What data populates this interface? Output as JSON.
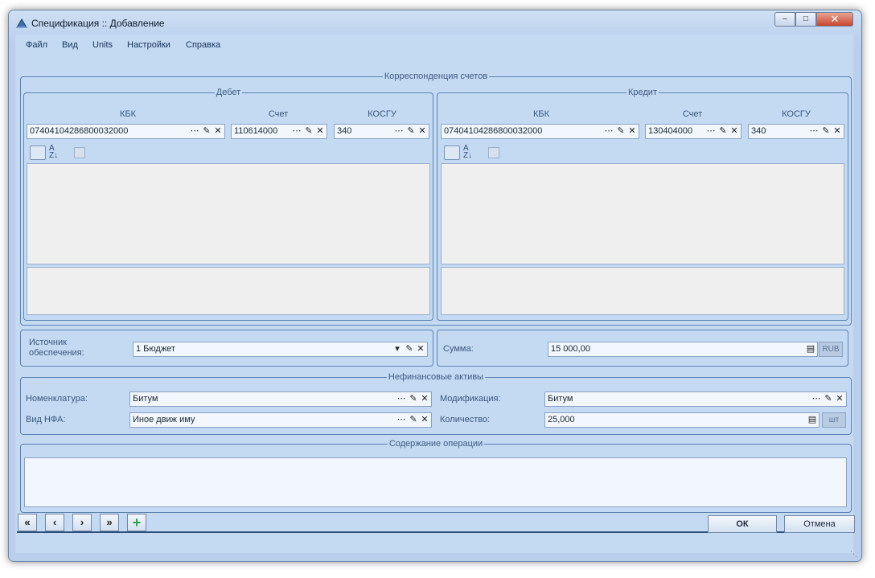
{
  "window": {
    "title": "Спецификация :: Добавление",
    "min": "–",
    "max": "□",
    "close": "✕"
  },
  "menu": [
    "Файл",
    "Вид",
    "Units",
    "Настройки",
    "Справка"
  ],
  "correspondence": {
    "legend": "Корреспонденция счетов",
    "debit": {
      "legend": "Дебет",
      "kbk_header": "КБК",
      "kbk": "07404104286800032000",
      "account_header": "Счет",
      "account": "110614000",
      "kosgu_header": "КОСГУ",
      "kosgu": "340"
    },
    "credit": {
      "legend": "Кредит",
      "kbk_header": "КБК",
      "kbk": "07404104286800032000",
      "account_header": "Счет",
      "account": "130404000",
      "kosgu_header": "КОСГУ",
      "kosgu": "340"
    }
  },
  "funding": {
    "label": "Источник обеспечения:",
    "value": "1 Бюджет"
  },
  "sum": {
    "label": "Сумма:",
    "value": "15 000,00",
    "currency": "RUB"
  },
  "nonfin": {
    "legend": "Нефинансовые активы",
    "nomenclature_label": "Номенклатура:",
    "nomenclature": "Битум",
    "nfa_type_label": "Вид НФА:",
    "nfa_type": "Иное движ иму",
    "modification_label": "Модификация:",
    "modification": "Битум",
    "quantity_label": "Количество:",
    "quantity": "25,000",
    "unit": "шт"
  },
  "operation": {
    "legend": "Содержание операции",
    "value": ""
  },
  "buttons": {
    "first": "«",
    "prev": "‹",
    "next": "›",
    "last": "»",
    "add": "+",
    "ok": "ОК",
    "cancel": "Отмена"
  },
  "icons": {
    "lookup": "⋯",
    "edit": "✎",
    "clear": "✕",
    "dropdown": "▾",
    "calc": "▤"
  },
  "colors": {
    "accent": "#2f4f7a",
    "add_green": "#2fa34a"
  }
}
